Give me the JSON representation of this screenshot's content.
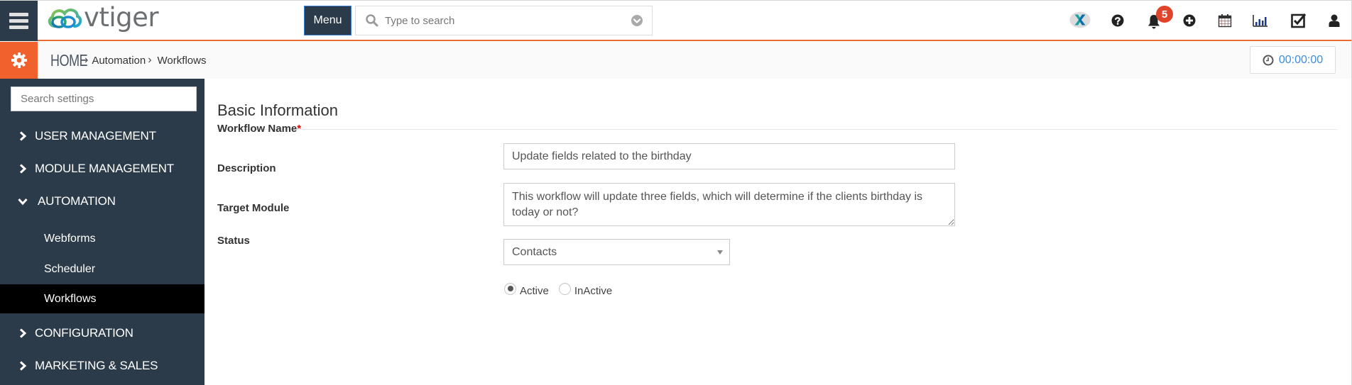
{
  "app": {
    "brand": "vtiger",
    "accent_color": "#f0612d",
    "sidebar_color": "#2c3b4a"
  },
  "topbar": {
    "menu_label": "Menu",
    "search_placeholder": "Type to search",
    "notification_count": "5",
    "icons": [
      "app-switcher-icon",
      "help-icon",
      "bell-icon",
      "add-icon",
      "calendar-icon",
      "reports-icon",
      "tasks-icon",
      "user-icon"
    ]
  },
  "breadcrumb": {
    "home": "HOME",
    "items": [
      "Automation",
      "Workflows"
    ]
  },
  "timer": {
    "value": "00:00:00"
  },
  "sidebar": {
    "search_placeholder": "Search settings",
    "sections": [
      {
        "label": "USER MANAGEMENT",
        "expanded": false
      },
      {
        "label": "MODULE MANAGEMENT",
        "expanded": false
      },
      {
        "label": "AUTOMATION",
        "expanded": true,
        "children": [
          {
            "label": "Webforms",
            "active": false
          },
          {
            "label": "Scheduler",
            "active": false
          },
          {
            "label": "Workflows",
            "active": true
          }
        ]
      },
      {
        "label": "CONFIGURATION",
        "expanded": false
      },
      {
        "label": "MARKETING & SALES",
        "expanded": false
      }
    ]
  },
  "form": {
    "section_title": "Basic Information",
    "workflow_name": {
      "label": "Workflow Name",
      "required_mark": "*",
      "value": "Update fields related to the birthday"
    },
    "description": {
      "label": "Description",
      "value": "This workflow will update three fields, which will determine if the clients birthday is today or not?"
    },
    "target_module": {
      "label": "Target Module",
      "value": "Contacts"
    },
    "status": {
      "label": "Status",
      "options": [
        "Active",
        "InActive"
      ],
      "selected": "Active"
    }
  }
}
